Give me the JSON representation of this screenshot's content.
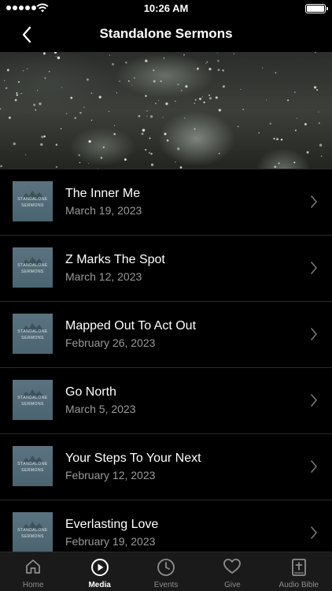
{
  "status_bar": {
    "time": "10:26 AM"
  },
  "header": {
    "title": "Standalone Sermons"
  },
  "thumbnail": {
    "line1": "STANDALONE",
    "line2": "SERMONS"
  },
  "sermons": [
    {
      "title": "The Inner Me",
      "date": "March 19, 2023"
    },
    {
      "title": "Z Marks The Spot",
      "date": "March 12, 2023"
    },
    {
      "title": "Mapped Out To Act Out",
      "date": "February 26, 2023"
    },
    {
      "title": "Go North",
      "date": "March 5, 2023"
    },
    {
      "title": "Your Steps To Your Next",
      "date": "February 12, 2023"
    },
    {
      "title": "Everlasting Love",
      "date": "February 19, 2023"
    }
  ],
  "tabs": [
    {
      "label": "Home",
      "icon": "home-icon",
      "active": false
    },
    {
      "label": "Media",
      "icon": "play-circle-icon",
      "active": true
    },
    {
      "label": "Events",
      "icon": "clock-icon",
      "active": false
    },
    {
      "label": "Give",
      "icon": "heart-icon",
      "active": false
    },
    {
      "label": "Audio Bible",
      "icon": "bible-icon",
      "active": false
    }
  ],
  "colors": {
    "background": "#000000",
    "tab_bar": "#1a1a1a",
    "secondary_text": "#9a9a9a",
    "thumbnail": "#56707c"
  }
}
